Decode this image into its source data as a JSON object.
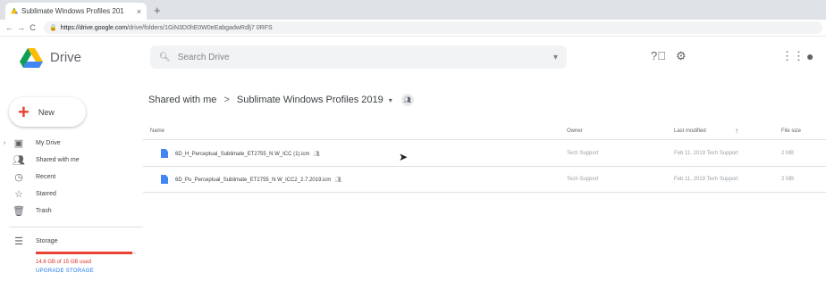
{
  "browser": {
    "tab_title": "Sublimate Windows Profiles 201",
    "tab_close": "×",
    "new_tab": "+",
    "url_host": "https://drive.google.com",
    "url_path": "/drive/folders/1GiN3D0hE0W0eEabgadwRdlj7 0RFS"
  },
  "header": {
    "brand": "Drive",
    "search_placeholder": "Search Drive"
  },
  "sidebar": {
    "new_label": "New",
    "items": [
      {
        "label": "My Drive",
        "icon": "drive-icon"
      },
      {
        "label": "Shared with me",
        "icon": "people-icon"
      },
      {
        "label": "Recent",
        "icon": "clock-icon"
      },
      {
        "label": "Starred",
        "icon": "star-icon"
      },
      {
        "label": "Trash",
        "icon": "trash-icon"
      }
    ],
    "storage_label": "Storage",
    "storage_used_fraction": 0.96,
    "storage_text": "14.6 GB of 15 GB used",
    "upgrade_label": "UPGRADE STORAGE"
  },
  "breadcrumb": {
    "root": "Shared with me",
    "separator": ">",
    "current": "Sublimate Windows Profiles 2019",
    "dropdown": "▾"
  },
  "columns": {
    "name": "Name",
    "owner": "Owner",
    "modified": "Last modified",
    "sort_arrow": "↑",
    "size": "File size"
  },
  "files": [
    {
      "name": "6D_H_Perceptual_Sublimate_ET2755_N W_ICC (1).icm",
      "owner": "Tech Support",
      "modified": "Feb 11, 2019 Tech Support",
      "size": "2 MB"
    },
    {
      "name": "6D_Pu_Perceptual_Sublimate_ET2755_N W_ICC2_2.7.2019.icm",
      "owner": "Tech Support",
      "modified": "Feb 11, 2019 Tech Support",
      "size": "2 MB"
    }
  ],
  "colors": {
    "accent_red": "#ea4335",
    "file_blue": "#4285f4",
    "link_blue": "#1a73e8"
  }
}
